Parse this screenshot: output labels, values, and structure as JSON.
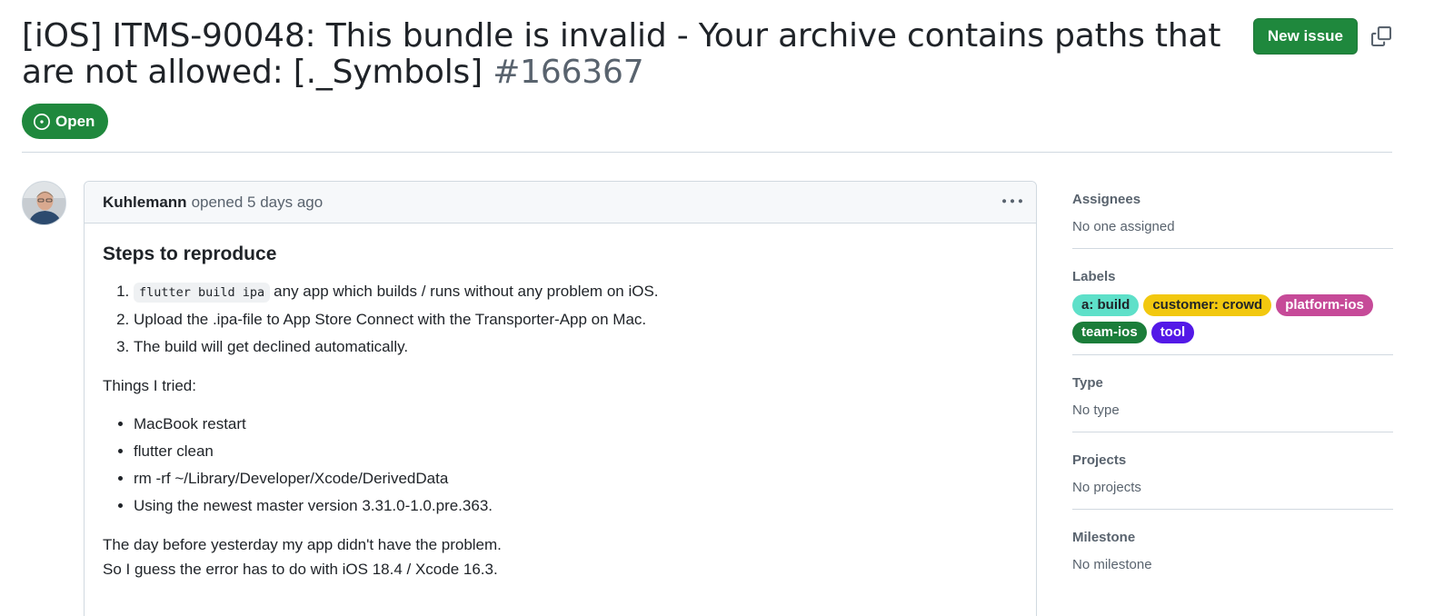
{
  "issue": {
    "title": "[iOS] ITMS-90048: This bundle is invalid - Your archive contains paths that are not allowed: [._Symbols]",
    "number": "#166367",
    "state": "Open"
  },
  "header": {
    "new_issue_label": "New issue"
  },
  "comment": {
    "author": "Kuhlemann",
    "meta": "opened 5 days ago",
    "heading": "Steps to reproduce",
    "steps": [
      {
        "code": "flutter build ipa",
        "text": "any app which builds / runs without any problem on iOS."
      },
      {
        "code": "",
        "text": "Upload the .ipa-file to App Store Connect with the Transporter-App on Mac."
      },
      {
        "code": "",
        "text": "The build will get declined automatically."
      }
    ],
    "tried_intro": "Things I tried:",
    "tried": [
      "MacBook restart",
      "flutter clean",
      "rm -rf ~/Library/Developer/Xcode/DerivedData",
      "Using the newest master version 3.31.0-1.0.pre.363."
    ],
    "para1": "The day before yesterday my app didn't have the problem.",
    "para2": "So I guess the error has to do with iOS 18.4 / Xcode 16.3."
  },
  "sidebar": {
    "assignees": {
      "label": "Assignees",
      "value": "No one assigned"
    },
    "labels": {
      "label": "Labels",
      "items": [
        {
          "text": "a: build",
          "bg": "#5ee0c9",
          "fg": "#1f2328"
        },
        {
          "text": "customer: crowd",
          "bg": "#f2c80f",
          "fg": "#1f2328"
        },
        {
          "text": "platform-ios",
          "bg": "#c64a98",
          "fg": "#ffffff"
        },
        {
          "text": "team-ios",
          "bg": "#1b7d3a",
          "fg": "#ffffff"
        },
        {
          "text": "tool",
          "bg": "#5319e7",
          "fg": "#ffffff"
        }
      ]
    },
    "type": {
      "label": "Type",
      "value": "No type"
    },
    "projects": {
      "label": "Projects",
      "value": "No projects"
    },
    "milestone": {
      "label": "Milestone",
      "value": "No milestone"
    }
  },
  "icons": {
    "copy": "copy-icon",
    "issue_open": "issue-opened-icon",
    "kebab": "kebab-horizontal-icon"
  },
  "colors": {
    "primary_green": "#1f883d",
    "muted_text": "#59636e",
    "border": "#d1d9e0"
  }
}
